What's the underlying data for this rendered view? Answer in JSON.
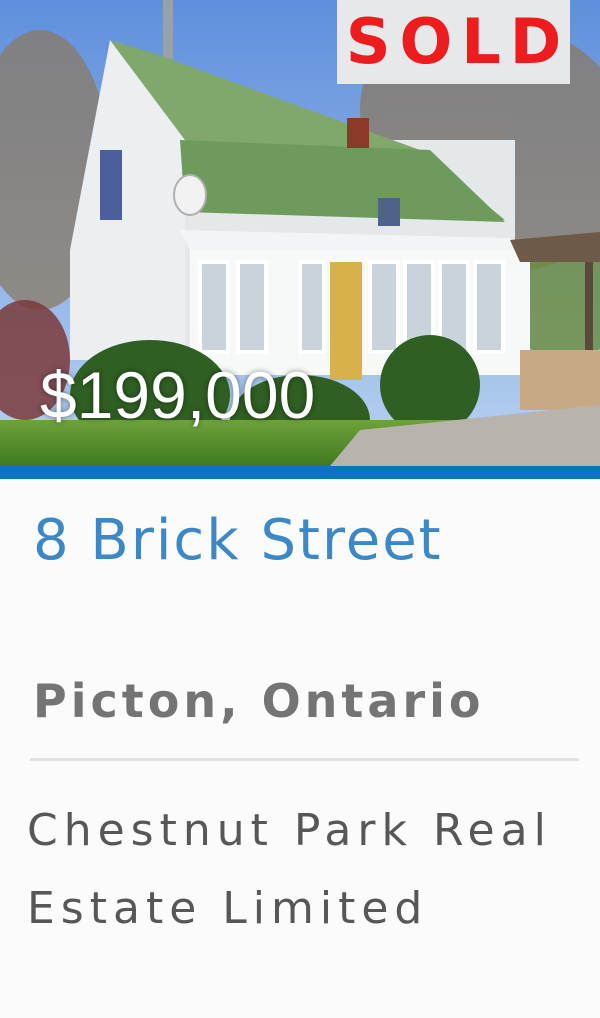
{
  "listing": {
    "badge": "SOLD",
    "price": "$199,000",
    "address": "8 Brick Street",
    "location": "Picton, Ontario",
    "brokerage": "Chestnut Park Real Estate Limited",
    "accent_color": "#0a73c2",
    "sold_color": "#ee1c1c",
    "address_color": "#3c87c6"
  }
}
